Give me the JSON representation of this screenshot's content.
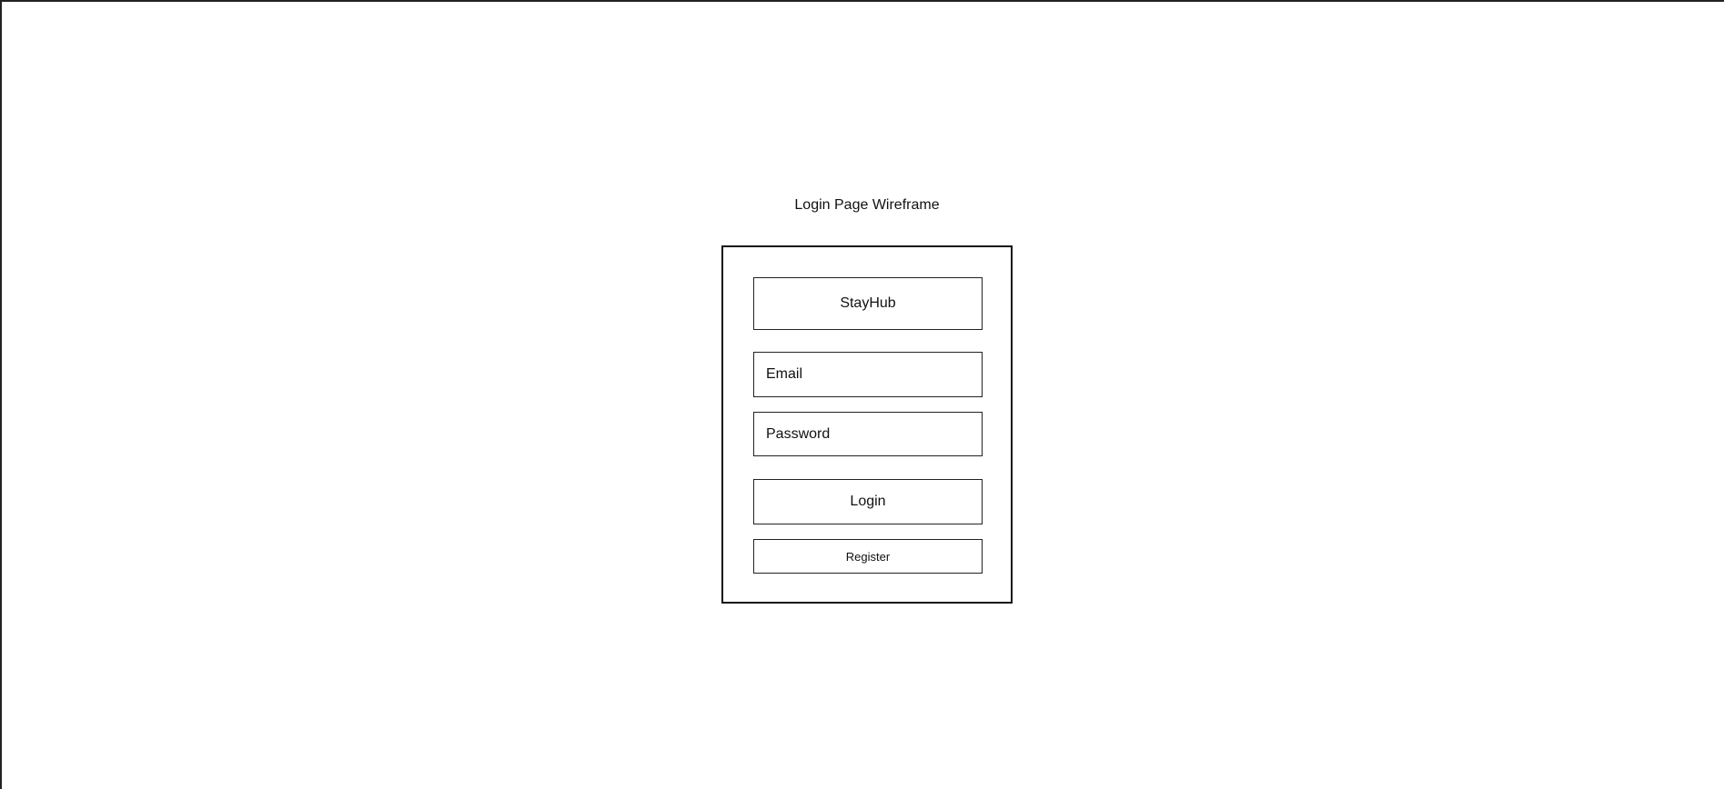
{
  "page": {
    "title": "Login Page Wireframe"
  },
  "login_form": {
    "brand": "StayHub",
    "email_label": "Email",
    "password_label": "Password",
    "login_label": "Login",
    "register_label": "Register"
  }
}
